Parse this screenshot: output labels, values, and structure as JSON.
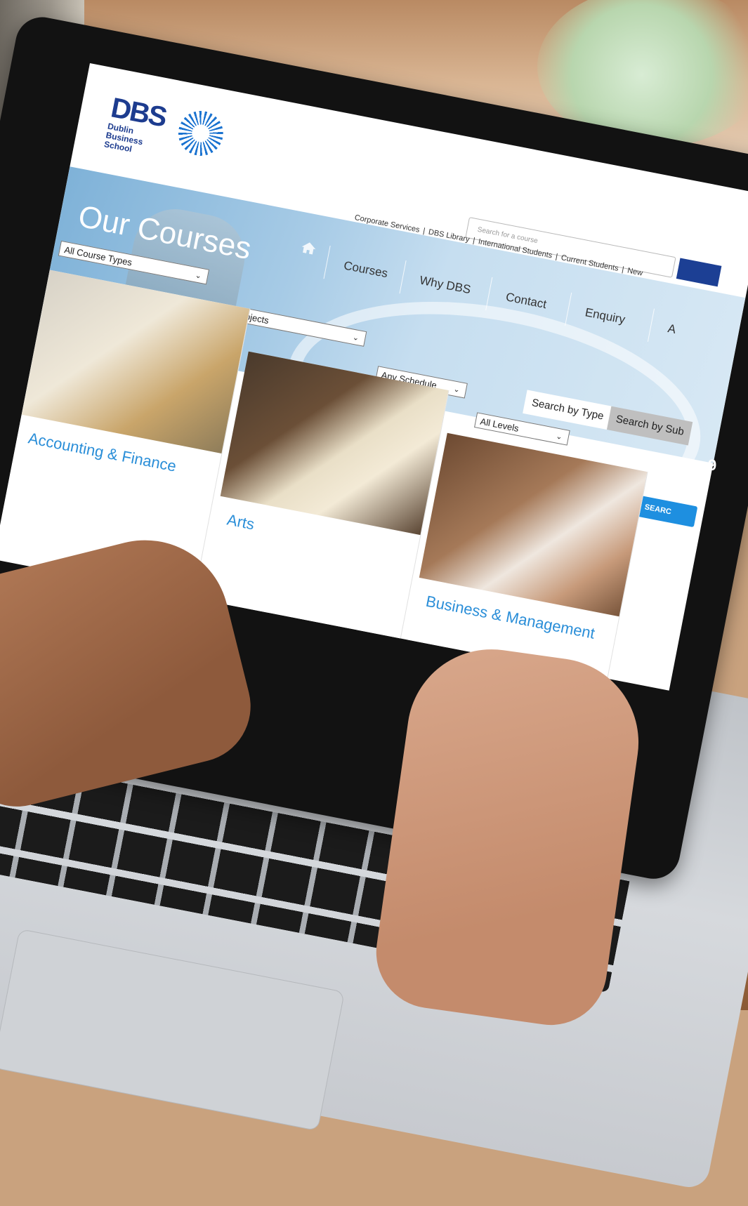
{
  "site": {
    "logo": {
      "acronym": "DBS",
      "name_lines": [
        "Dublin",
        "Business",
        "School"
      ]
    },
    "search": {
      "placeholder": "Search for a course"
    },
    "utility_links": [
      "Corporate Services",
      "DBS Library",
      "International Students",
      "Current Students",
      "New"
    ],
    "banner": {
      "title": "Our Courses"
    },
    "nav": [
      "Courses",
      "Why DBS",
      "Contact",
      "Enquiry",
      "A"
    ],
    "filters": {
      "course_type": "All Course Types",
      "subject": "All Subjects",
      "schedule": "Any Schedule",
      "level": "All Levels"
    },
    "tabs": {
      "by_type": "Search by Type",
      "by_subject": "Search by Sub"
    },
    "search_button": "SEARC",
    "cards": [
      {
        "title": "Accounting & Finance"
      },
      {
        "title": "Arts"
      },
      {
        "title": "Business & Management"
      }
    ]
  },
  "page_number": "9",
  "colors": {
    "brand_blue": "#1d3c8f",
    "link_blue": "#2a8ed8",
    "banner_blue": "#a7cbe6"
  }
}
